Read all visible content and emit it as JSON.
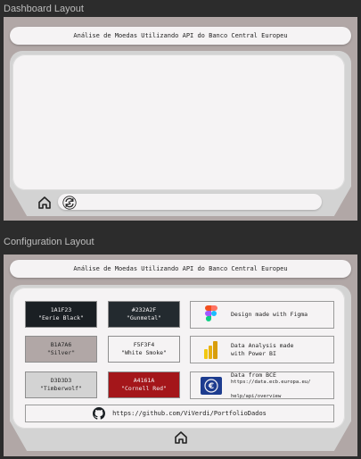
{
  "sections": {
    "dashboard_label": "Dashboard Layout",
    "config_label": "Configuration Layout"
  },
  "title": "Análise de Moedas Utilizando API do Banco Central Europeu",
  "swatches": [
    {
      "hex": "1A1F23",
      "name": "\"Eerie Black\"",
      "bg": "#1a1f23",
      "fg": "#f5f3f4"
    },
    {
      "hex": "#232A2F",
      "name": "\"Gunmetal\"",
      "bg": "#232a2f",
      "fg": "#f5f3f4"
    },
    {
      "hex": "B1A7A6",
      "name": "\"Silver\"",
      "bg": "#b1a7a6",
      "fg": "#232323"
    },
    {
      "hex": "F5F3F4",
      "name": "\"White Smoke\"",
      "bg": "#f5f3f4",
      "fg": "#232323"
    },
    {
      "hex": "D3D3D3",
      "name": "\"Timberwolf\"",
      "bg": "#d3d3d3",
      "fg": "#232323"
    },
    {
      "hex": "A4161A",
      "name": "\"Cornell Red\"",
      "bg": "#a4161a",
      "fg": "#f5f3f4"
    }
  ],
  "info": {
    "figma": "Design made with Figma",
    "powerbi_1": "Data Analysis made",
    "powerbi_2": "with Power BI",
    "bce_title": "Data from BCE",
    "bce_url_1": "https://data.ecb.europa.eu/",
    "bce_url_2": "help/api/overview"
  },
  "github_url": "https://github.com/ViVerdi/PortfolioDados",
  "icons": {
    "home": "home-icon",
    "refresh": "refresh-icon",
    "figma": "figma-logo",
    "powerbi": "powerbi-logo",
    "ecb": "ecb-logo",
    "github": "github-icon"
  }
}
